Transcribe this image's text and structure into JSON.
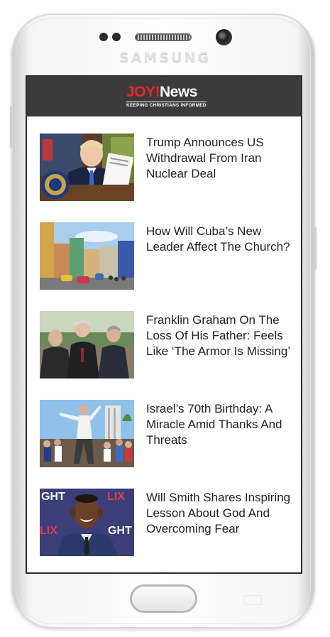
{
  "device": {
    "brand_label": "SAMSUNG"
  },
  "app": {
    "logo_joy": "JOY!",
    "logo_news": "News",
    "tagline": "KEEPING CHRISTIANS INFORMED",
    "colors": {
      "header_bg": "#3b3b3b",
      "logo_red": "#e8262b"
    }
  },
  "articles": [
    {
      "title": "Trump Announces US Withdrawal From Iran Nuclear Deal",
      "image_icon": "trump-signing-photo"
    },
    {
      "title": "How Will Cuba’s New Leader Affect The Church?",
      "image_icon": "havana-street-photo"
    },
    {
      "title": "Franklin Graham On The Loss Of His Father: Feels Like ‘The Armor Is Missing’",
      "image_icon": "franklin-graham-photo"
    },
    {
      "title": "Israel’s 70th Birthday: A Miracle Amid Thanks And Threats",
      "image_icon": "israel-celebration-photo"
    },
    {
      "title": "Will Smith Shares Inspiring Lesson About God And Overcoming Fear",
      "image_icon": "will-smith-photo"
    }
  ]
}
